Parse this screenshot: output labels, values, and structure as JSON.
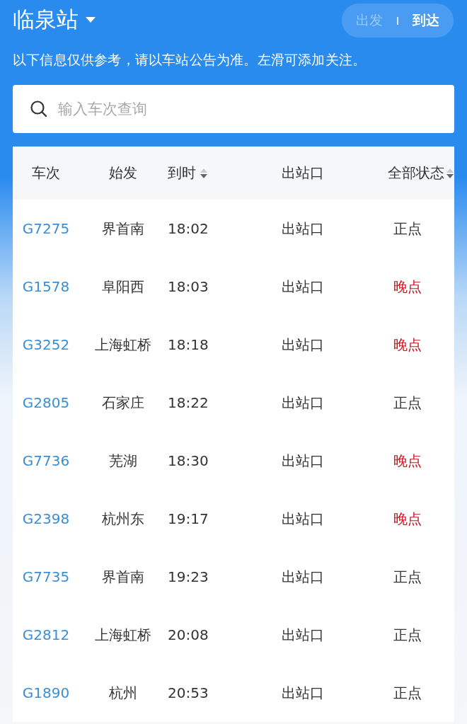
{
  "header": {
    "station": "临泉站",
    "toggle": [
      {
        "label": "出发",
        "selected": false
      },
      {
        "label": "到达",
        "selected": true
      }
    ],
    "notice": "以下信息仅供参考，请以车站公告为准。左滑可添加关注。"
  },
  "search": {
    "placeholder": "输入车次查询"
  },
  "table": {
    "columns": [
      {
        "label": "车次",
        "sortable": false
      },
      {
        "label": "始发",
        "sortable": false
      },
      {
        "label": "到时",
        "sortable": true
      },
      {
        "label": "出站口",
        "sortable": false
      },
      {
        "label": "全部状态",
        "sortable": true
      }
    ],
    "rows": [
      {
        "train": "G7275",
        "origin": "界首南",
        "arrival": "18:02",
        "exit": "出站口",
        "status": "正点",
        "late": false
      },
      {
        "train": "G1578",
        "origin": "阜阳西",
        "arrival": "18:03",
        "exit": "出站口",
        "status": "晚点",
        "late": true
      },
      {
        "train": "G3252",
        "origin": "上海虹桥",
        "arrival": "18:18",
        "exit": "出站口",
        "status": "晚点",
        "late": true
      },
      {
        "train": "G2805",
        "origin": "石家庄",
        "arrival": "18:22",
        "exit": "出站口",
        "status": "正点",
        "late": false
      },
      {
        "train": "G7736",
        "origin": "芜湖",
        "arrival": "18:30",
        "exit": "出站口",
        "status": "晚点",
        "late": true
      },
      {
        "train": "G2398",
        "origin": "杭州东",
        "arrival": "19:17",
        "exit": "出站口",
        "status": "晚点",
        "late": true
      },
      {
        "train": "G7735",
        "origin": "界首南",
        "arrival": "19:23",
        "exit": "出站口",
        "status": "正点",
        "late": false
      },
      {
        "train": "G2812",
        "origin": "上海虹桥",
        "arrival": "20:08",
        "exit": "出站口",
        "status": "正点",
        "late": false
      },
      {
        "train": "G1890",
        "origin": "杭州",
        "arrival": "20:53",
        "exit": "出站口",
        "status": "正点",
        "late": false
      }
    ]
  }
}
